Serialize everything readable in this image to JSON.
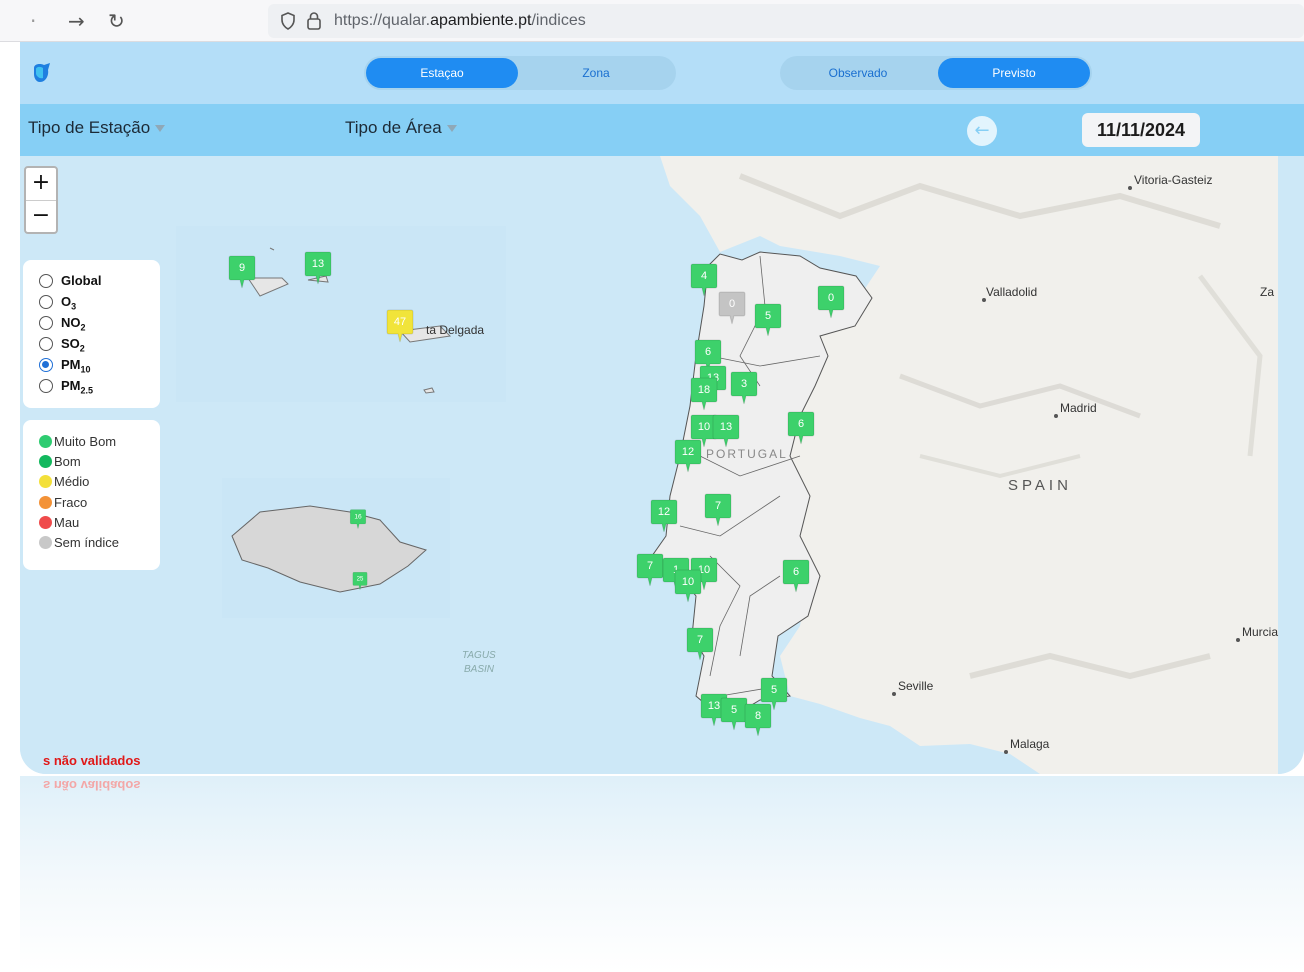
{
  "browser": {
    "back_icon": "arrow-left-icon",
    "forward_icon": "arrow-right-icon",
    "reload_icon": "reload-icon",
    "url_prefix": "https://qualar.",
    "url_domain": "apambiente.pt",
    "url_path": "/indices"
  },
  "topbar": {
    "toggle_left": {
      "options": [
        "Estaçao",
        "Zona"
      ],
      "selected": "Estaçao"
    },
    "toggle_right": {
      "options": [
        "Observado",
        "Previsto"
      ],
      "selected": "Previsto"
    }
  },
  "filters": {
    "station_type": "Tipo de Estação",
    "area_type": "Tipo de Área",
    "date": "11/11/2024"
  },
  "pollutants": {
    "options": [
      "Global",
      "O3",
      "NO2",
      "SO2",
      "PM10",
      "PM2.5"
    ],
    "selected": "PM10"
  },
  "legend": {
    "items": [
      {
        "label": "Muito Bom",
        "color": "#2ecc71"
      },
      {
        "label": "Bom",
        "color": "#13b85e"
      },
      {
        "label": "Médio",
        "color": "#f3e03a"
      },
      {
        "label": "Fraco",
        "color": "#f39237"
      },
      {
        "label": "Mau",
        "color": "#ef4b4b"
      },
      {
        "label": "Sem índice",
        "color": "#c8c8c8"
      }
    ]
  },
  "map": {
    "places": [
      "Vitoria-Gasteiz",
      "Valladolid",
      "Za",
      "Madrid",
      "SPAIN",
      "PORTUGAL",
      "Seville",
      "Murcia",
      "Malaga",
      "ta Delgada",
      "TAGUS",
      "BASIN"
    ],
    "markers": [
      "9",
      "13",
      "47",
      "16",
      "25",
      "4",
      "0",
      "0",
      "5",
      "6",
      "13",
      "3",
      "18",
      "6",
      "10",
      "13",
      "12",
      "12",
      "7",
      "7",
      "1",
      "10",
      "10",
      "6",
      "7",
      "5",
      "13",
      "5",
      "8"
    ],
    "marker_colors": {
      "good": "#3dd16b",
      "medium": "#f1e43a",
      "none": "#c4c4c4"
    }
  },
  "notice": "s não validados",
  "colors": {
    "topbar": "#b4def8",
    "filterbar": "#86cff5",
    "accent": "#1f8cf2",
    "sea": "#cde8f7",
    "land": "#f1f0ec"
  }
}
